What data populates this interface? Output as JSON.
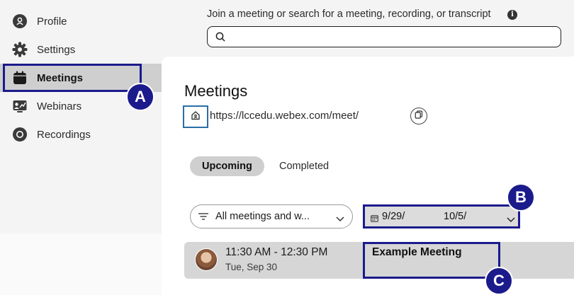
{
  "sidebar": {
    "items": [
      {
        "label": "Profile",
        "icon": "profile-icon"
      },
      {
        "label": "Settings",
        "icon": "gear-icon"
      },
      {
        "label": "Meetings",
        "icon": "calendar-icon",
        "active": true
      },
      {
        "label": "Webinars",
        "icon": "webinar-icon"
      },
      {
        "label": "Recordings",
        "icon": "record-icon"
      }
    ]
  },
  "search": {
    "hint": "Join a meeting or search for a meeting, recording, or transcript",
    "placeholder": ""
  },
  "main": {
    "title": "Meetings",
    "room_url": "https://lccedu.webex.com/meet/",
    "tabs": [
      {
        "label": "Upcoming",
        "selected": true
      },
      {
        "label": "Completed",
        "selected": false
      }
    ],
    "filter": {
      "value": "All meetings and w..."
    },
    "date_range": {
      "start": "9/29/",
      "end": "10/5/"
    },
    "meetings": [
      {
        "time": "11:30 AM - 12:30 PM",
        "date": "Tue, Sep 30",
        "title": "Example Meeting"
      }
    ]
  },
  "callouts": {
    "a": "A",
    "b": "B",
    "c": "C"
  },
  "colors": {
    "accent": "#1b1b8c",
    "room_icon_border": "#2a6ea5",
    "active_item": "#cfcfcf"
  }
}
